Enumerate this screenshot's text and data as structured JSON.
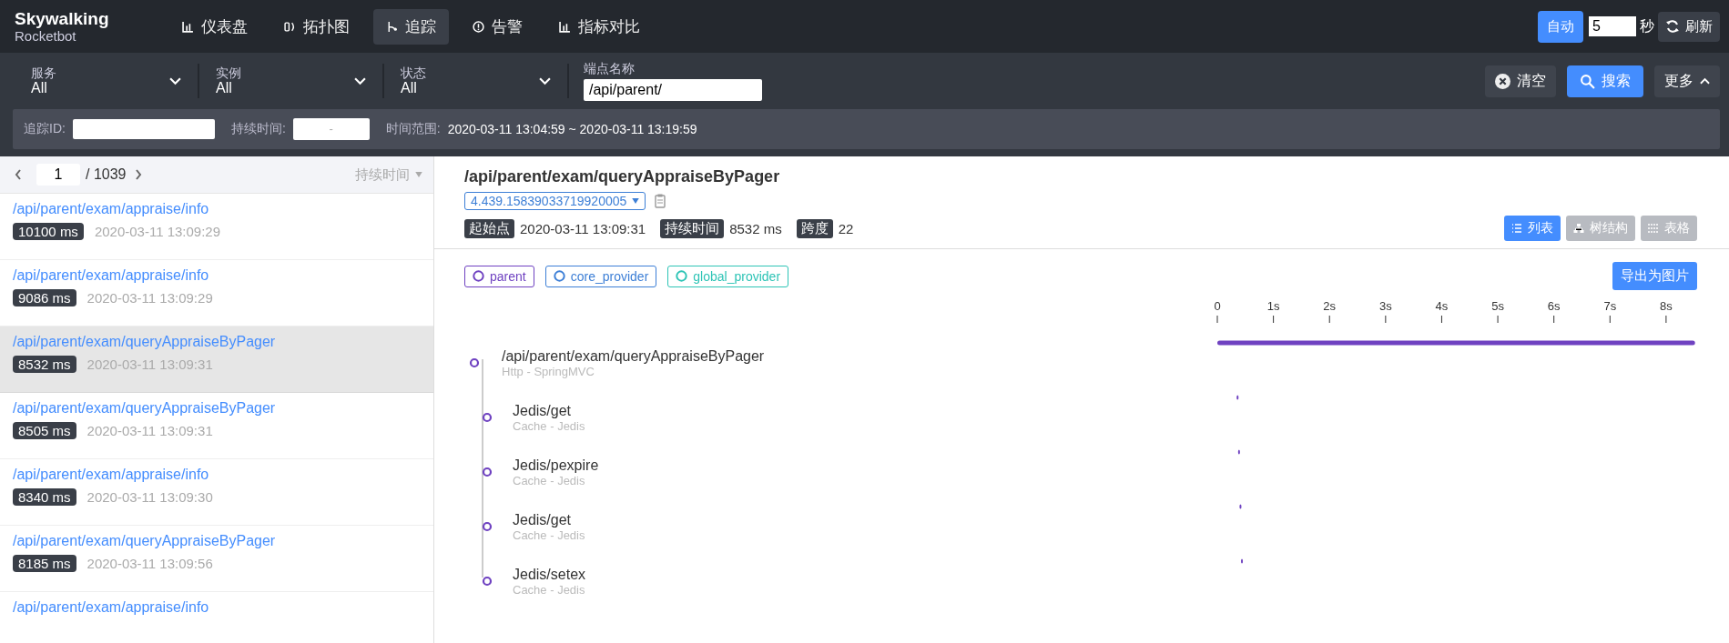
{
  "brand": {
    "name": "Skywalking",
    "subtitle": "Rocketbot"
  },
  "nav": [
    {
      "label": "仪表盘",
      "kind": "chart",
      "selected": false
    },
    {
      "label": "拓扑图",
      "kind": "topo",
      "selected": false
    },
    {
      "label": "追踪",
      "kind": "trace",
      "selected": true
    },
    {
      "label": "告警",
      "kind": "alert",
      "selected": false
    },
    {
      "label": "指标对比",
      "kind": "chart",
      "selected": false
    }
  ],
  "auto_refresh": {
    "auto_label": "自动",
    "on": true,
    "interval": "5",
    "unit": "秒",
    "refresh_label": "刷新"
  },
  "filters": {
    "selects": [
      {
        "label": "服务",
        "value": "All"
      },
      {
        "label": "实例",
        "value": "All"
      },
      {
        "label": "状态",
        "value": "All"
      }
    ],
    "endpoint": {
      "label": "端点名称",
      "value": "/api/parent/"
    },
    "clear_label": "清空",
    "search_label": "搜索",
    "more": {
      "label": "更多",
      "expanded": true
    },
    "trace_id": {
      "label": "追踪ID:"
    },
    "duration": {
      "label": "持续时间:",
      "separator": "-"
    },
    "time_range": {
      "label": "时间范围:",
      "value": "2020-03-11 13:04:59 ~ 2020-03-11 13:19:59"
    }
  },
  "trace_list": {
    "page": "1",
    "total": "/ 1039",
    "sort_label": "持续时间",
    "rows": [
      {
        "endpoint": "/api/parent/exam/appraise/info",
        "duration": "10100 ms",
        "time": "2020-03-11 13:09:29",
        "selected": false
      },
      {
        "endpoint": "/api/parent/exam/appraise/info",
        "duration": "9086 ms",
        "time": "2020-03-11 13:09:29",
        "selected": false
      },
      {
        "endpoint": "/api/parent/exam/queryAppraiseByPager",
        "duration": "8532 ms",
        "time": "2020-03-11 13:09:31",
        "selected": true
      },
      {
        "endpoint": "/api/parent/exam/queryAppraiseByPager",
        "duration": "8505 ms",
        "time": "2020-03-11 13:09:31",
        "selected": false
      },
      {
        "endpoint": "/api/parent/exam/appraise/info",
        "duration": "8340 ms",
        "time": "2020-03-11 13:09:30",
        "selected": false
      },
      {
        "endpoint": "/api/parent/exam/queryAppraiseByPager",
        "duration": "8185 ms",
        "time": "2020-03-11 13:09:56",
        "selected": false
      },
      {
        "endpoint": "/api/parent/exam/appraise/info",
        "selected": false
      }
    ]
  },
  "detail": {
    "title": "/api/parent/exam/queryAppraiseByPager",
    "trace_id": "4.439.15839033719920005",
    "meta": [
      {
        "label": "起始点",
        "value": "2020-03-11 13:09:31"
      },
      {
        "label": "持续时间",
        "value": "8532 ms"
      },
      {
        "label": "跨度",
        "value": "22"
      }
    ],
    "views": [
      {
        "label": "列表",
        "kind": "list",
        "selected": true
      },
      {
        "label": "树结构",
        "kind": "tree",
        "selected": false
      },
      {
        "label": "表格",
        "kind": "table",
        "selected": false
      }
    ],
    "services": [
      {
        "name": "parent",
        "color": "#6f42c1"
      },
      {
        "name": "core_provider",
        "color": "#3d7fd6"
      },
      {
        "name": "global_provider",
        "color": "#2ec4b6"
      }
    ],
    "export_label": "导出为图片",
    "timeline_ticks": [
      "0",
      "1s",
      "2s",
      "3s",
      "4s",
      "5s",
      "6s",
      "7s",
      "8s"
    ],
    "spans": [
      {
        "name": "/api/parent/exam/queryAppraiseByPager",
        "type": "Http - SpringMVC",
        "level": 0.99,
        "children": [
          {
            "name": "Jedis/get",
            "type": "Cache - Jedis",
            "level": 0.004
          },
          {
            "name": "Jedis/pexpire",
            "type": "Cache - Jedis",
            "level": 0.004
          },
          {
            "name": "Jedis/get",
            "type": "Cache - Jedis",
            "level": 0.004
          },
          {
            "name": "Jedis/setex",
            "type": "Cache - Jedis",
            "level": 0.004
          }
        ]
      }
    ]
  }
}
